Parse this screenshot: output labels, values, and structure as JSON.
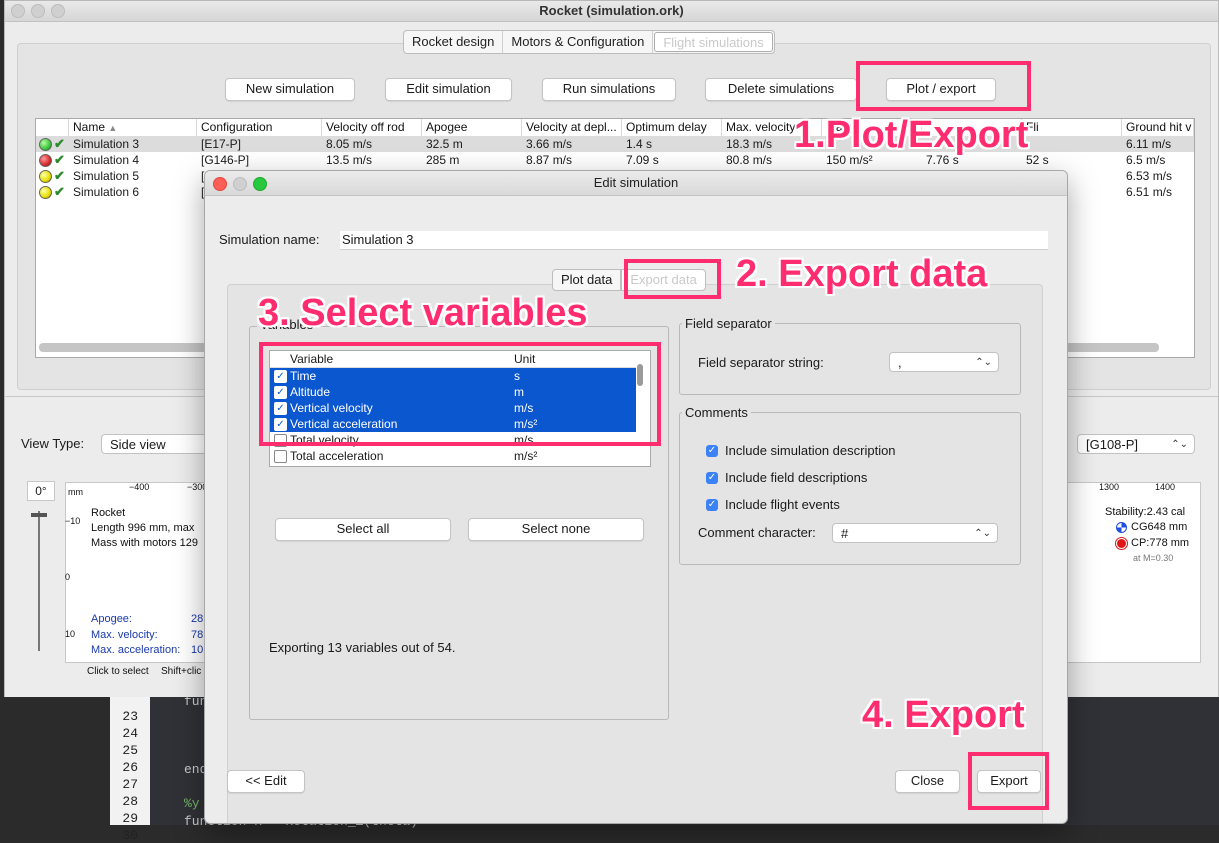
{
  "editor": {
    "lines": [
      "23",
      "24",
      "25",
      "26",
      "27",
      "28",
      "29",
      "30"
    ],
    "code_fun": "fun",
    "code_end": "end",
    "code_comment": "%y",
    "code_last": "function R = Rotation_Z(theta)"
  },
  "window": {
    "title": "Rocket (simulation.ork)",
    "tabs": [
      "Rocket design",
      "Motors & Configuration",
      "Flight simulations"
    ]
  },
  "toolbar": {
    "new": "New simulation",
    "edit": "Edit simulation",
    "run": "Run simulations",
    "delete": "Delete simulations",
    "plot": "Plot / export"
  },
  "sim_table": {
    "headers": [
      "Name",
      "Configuration",
      "Velocity off rod",
      "Apogee",
      "Velocity at depl...",
      "Optimum delay",
      "Max. velocity",
      "Ma",
      "",
      "Fli",
      "Ground hit v"
    ],
    "sort_arrow": "▲",
    "rows": [
      {
        "name": "Simulation 3",
        "config": "[E17-P]",
        "vrod": "8.05 m/s",
        "apogee": "32.5 m",
        "vdepl": "3.66 m/s",
        "delay": "1.4 s",
        "vmax": "18.3 m/s",
        "amax": "",
        "c9": "",
        "c10": "",
        "ground": "6.11 m/s",
        "status": "green"
      },
      {
        "name": "Simulation 4",
        "config": "[G146-P]",
        "vrod": "13.5 m/s",
        "apogee": "285 m",
        "vdepl": "8.87 m/s",
        "delay": "7.09 s",
        "vmax": "80.8 m/s",
        "amax": "150 m/s²",
        "c9": "7.76 s",
        "c10": "52 s",
        "ground": "6.5 m/s",
        "status": "red"
      },
      {
        "name": "Simulation 5",
        "config": "[C",
        "vrod": "",
        "apogee": "",
        "vdepl": "",
        "delay": "",
        "vmax": "",
        "amax": "",
        "c9": "",
        "c10": "",
        "ground": "6.53 m/s",
        "status": "yellow"
      },
      {
        "name": "Simulation 6",
        "config": "[C",
        "vrod": "",
        "apogee": "",
        "vdepl": "",
        "delay": "",
        "vmax": "",
        "amax": "",
        "c9": "",
        "c10": "",
        "ground": "6.51 m/s",
        "status": "yellow"
      }
    ]
  },
  "lower": {
    "view_type_label": "View Type:",
    "view_type_value": "Side view",
    "config_value": "[G108-P]",
    "angle": "0°",
    "ruler_unit": "mm",
    "ruler_ticks_left": [
      "−400",
      "−300"
    ],
    "ruler_ticks_right": [
      "1300",
      "1400"
    ],
    "vruler_ticks": [
      "−10",
      "0",
      "10"
    ],
    "rocket_name": "Rocket",
    "rocket_length": "Length 996 mm, max",
    "rocket_mass": "Mass with motors 129",
    "apogee_label": "Apogee:",
    "apogee_value": "28",
    "maxvel_label": "Max. velocity:",
    "maxvel_value": "78",
    "maxacc_label": "Max. acceleration:",
    "maxacc_value": "10",
    "stability": "Stability:2.43 cal",
    "cg": "CG648 mm",
    "cp": "CP:778 mm",
    "mach": "at M=0.30",
    "hint1": "Click to select",
    "hint2": "Shift+clic"
  },
  "dialog": {
    "title": "Edit simulation",
    "name_label": "Simulation name:",
    "name_value": "Simulation 3",
    "tabs": [
      "Plot data",
      "Export data"
    ],
    "group_vars_title": "Variables",
    "col_variable": "Variable",
    "col_unit": "Unit",
    "variables": [
      {
        "name": "Time",
        "unit": "s",
        "checked": true
      },
      {
        "name": "Altitude",
        "unit": "m",
        "checked": true
      },
      {
        "name": "Vertical velocity",
        "unit": "m/s",
        "checked": true
      },
      {
        "name": "Vertical acceleration",
        "unit": "m/s²",
        "checked": true
      },
      {
        "name": "Total velocity",
        "unit": "m/s",
        "checked": false
      },
      {
        "name": "Total acceleration",
        "unit": "m/s²",
        "checked": false
      }
    ],
    "select_all": "Select all",
    "select_none": "Select none",
    "export_status": "Exporting 13 variables out of 54.",
    "field_sep_title": "Field separator",
    "field_sep_label": "Field separator string:",
    "field_sep_value": ",",
    "comments_title": "Comments",
    "opt_desc": "Include simulation description",
    "opt_fields": "Include field descriptions",
    "opt_events": "Include flight events",
    "comment_char_label": "Comment character:",
    "comment_char_value": "#",
    "back": "<< Edit",
    "close": "Close",
    "export": "Export"
  },
  "annotations": {
    "step1": "1.Plot/Export",
    "step2": "2. Export data",
    "step3": "3. Select variables",
    "step4": "4. Export"
  },
  "colors": {
    "annotation": "#ff2d6f",
    "selection": "#0b57d0",
    "status_green": "#3cc43c",
    "status_red": "#d42a2a",
    "status_yellow": "#e8e000"
  }
}
